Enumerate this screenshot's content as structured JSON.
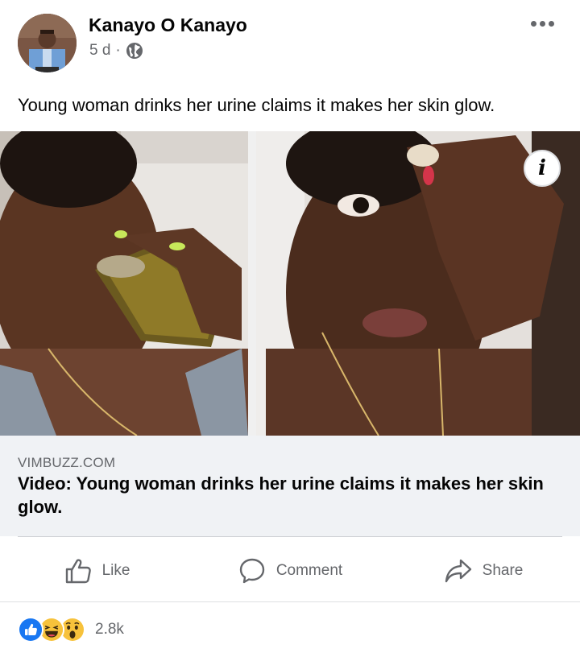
{
  "post": {
    "author": "Kanayo O Kanayo",
    "time": "5 d",
    "separator": "·",
    "privacy_icon": "globe-icon",
    "text": "Young woman drinks her urine claims it makes her skin glow."
  },
  "media": {
    "info_glyph": "i"
  },
  "link": {
    "domain": "VIMBUZZ.COM",
    "title": "Video: Young woman drinks her urine claims it makes her skin glow."
  },
  "actions": {
    "like": "Like",
    "comment": "Comment",
    "share": "Share"
  },
  "reactions": {
    "icons": [
      "like-icon",
      "haha-icon",
      "wow-icon"
    ],
    "count": "2.8k"
  },
  "colors": {
    "secondary_text": "#65676b",
    "card_background": "#f0f2f5",
    "like_blue": "#1877f2",
    "emoji_yellow": "#f7c23b"
  }
}
